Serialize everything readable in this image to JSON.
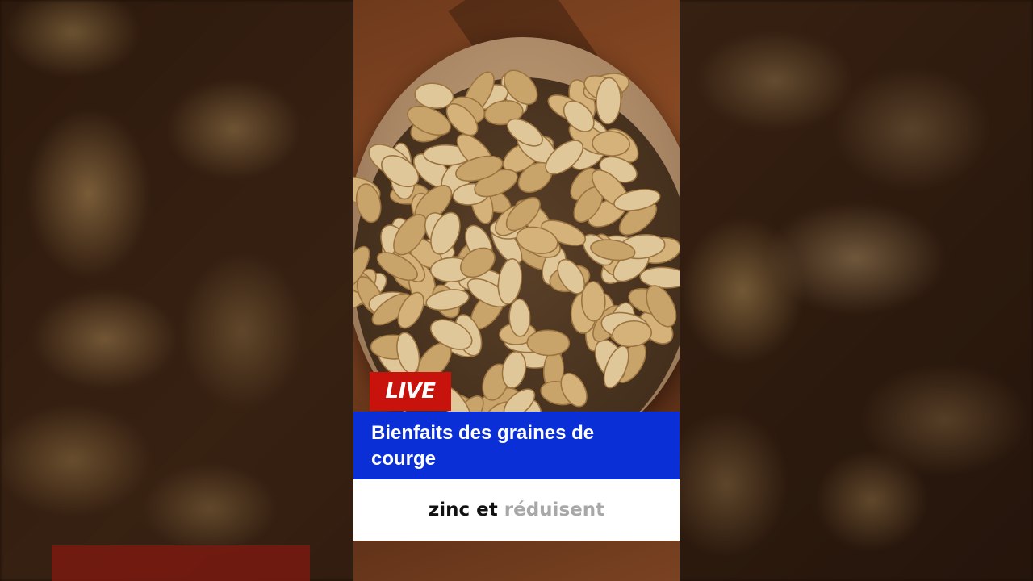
{
  "overlay": {
    "live_label": "LIVE",
    "title": "Bienfaits des graines de courge",
    "caption_spoken": "zinc et",
    "caption_upcoming": "réduisent"
  },
  "colors": {
    "live_badge": "#c8120c",
    "title_banner": "#0b2fd6",
    "caption_background": "#ffffff",
    "caption_spoken": "#111111",
    "caption_upcoming": "#a8a8a8"
  },
  "media": {
    "subject": "pumpkin-seeds-bowl-image"
  }
}
